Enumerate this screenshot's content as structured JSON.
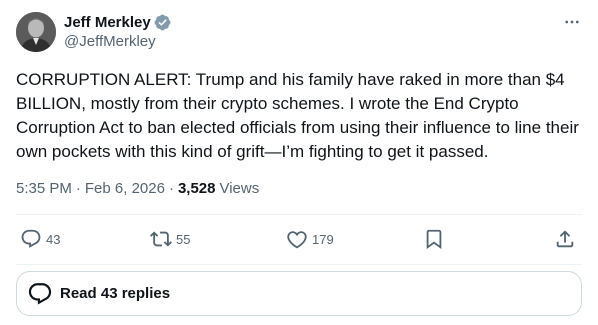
{
  "author": {
    "display_name": "Jeff Merkley",
    "handle": "@JeffMerkley",
    "verified": true
  },
  "tweet": {
    "text": "CORRUPTION ALERT: Trump and his family have raked in more than $4 BILLION, mostly from their crypto schemes. I wrote the End Crypto Corruption Act to ban elected officials from using their influence to line their own pockets with this kind of grift—I’m fighting to get it passed.",
    "time": "5:35 PM",
    "separator": "·",
    "date": "Feb 6, 2026",
    "views_count": "3,528",
    "views_label": "Views"
  },
  "actions": {
    "replies": "43",
    "reposts": "55",
    "likes": "179"
  },
  "read_replies": {
    "label": "Read 43 replies"
  },
  "icons": {
    "verified": "verified-badge-icon",
    "more": "more-horizontal-icon",
    "reply": "reply-icon",
    "repost": "repost-icon",
    "like": "heart-icon",
    "bookmark": "bookmark-icon",
    "share": "share-icon",
    "read_replies": "speech-bubble-icon"
  },
  "colors": {
    "text": "#0f1419",
    "secondary": "#536471",
    "verified": "#829aab",
    "border": "#cfd9de",
    "divider": "#eff3f4"
  }
}
